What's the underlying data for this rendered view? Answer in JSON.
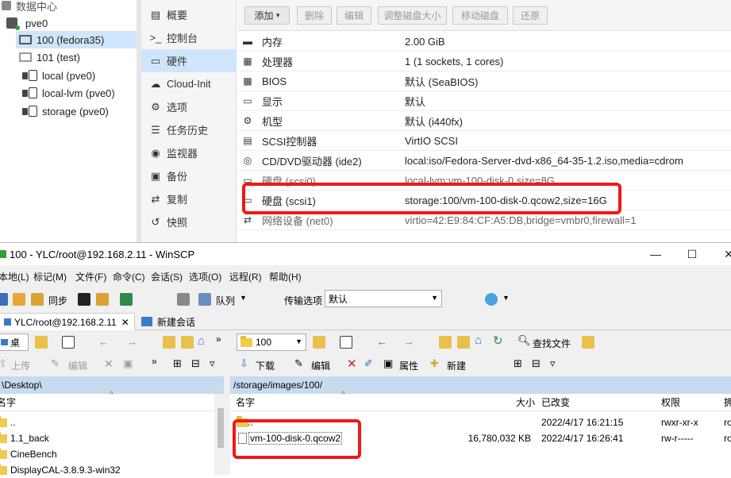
{
  "pve": {
    "tree": {
      "datacenter": "数据中心",
      "node": "pve0",
      "items": [
        {
          "label": "100 (fedora35)",
          "type": "vm",
          "selected": true
        },
        {
          "label": "101 (test)",
          "type": "vm-off"
        },
        {
          "label": "local (pve0)",
          "type": "storage"
        },
        {
          "label": "local-lvm (pve0)",
          "type": "storage"
        },
        {
          "label": "storage (pve0)",
          "type": "storage"
        }
      ]
    },
    "nav": [
      {
        "label": "概要",
        "icon": "document-icon"
      },
      {
        "label": "控制台",
        "icon": "terminal-icon"
      },
      {
        "label": "硬件",
        "icon": "monitor-icon",
        "selected": true
      },
      {
        "label": "Cloud-Init",
        "icon": "cloud-icon"
      },
      {
        "label": "选项",
        "icon": "gear-icon"
      },
      {
        "label": "任务历史",
        "icon": "list-icon"
      },
      {
        "label": "监视器",
        "icon": "eye-icon"
      },
      {
        "label": "备份",
        "icon": "floppy-icon"
      },
      {
        "label": "复制",
        "icon": "retweet-icon"
      },
      {
        "label": "快照",
        "icon": "history-icon"
      }
    ],
    "toolbar": {
      "add": "添加",
      "remove": "删除",
      "edit": "编辑",
      "resize": "调整磁盘大小",
      "move": "移动磁盘",
      "revert": "还原"
    },
    "hardware": [
      {
        "key": "内存",
        "value": "2.00 GiB",
        "icon": "memory-icon"
      },
      {
        "key": "处理器",
        "value": "1 (1 sockets, 1 cores)",
        "icon": "cpu-icon"
      },
      {
        "key": "BIOS",
        "value": "默认 (SeaBIOS)",
        "icon": "chip-icon"
      },
      {
        "key": "显示",
        "value": "默认",
        "icon": "display-icon"
      },
      {
        "key": "机型",
        "value": "默认 (i440fx)",
        "icon": "cogs-icon"
      },
      {
        "key": "SCSI控制器",
        "value": "VirtIO SCSI",
        "icon": "database-icon"
      },
      {
        "key": "CD/DVD驱动器 (ide2)",
        "value": "local:iso/Fedora-Server-dvd-x86_64-35-1.2.iso,media=cdrom",
        "icon": "cdrom-icon"
      },
      {
        "key": "硬盘 (scsi0)",
        "value": "local-lvm:vm-100-disk-0,size=8G",
        "icon": "hdd-icon"
      },
      {
        "key": "硬盘 (scsi1)",
        "value": "storage:100/vm-100-disk-0.qcow2,size=16G",
        "icon": "hdd-icon"
      },
      {
        "key": "网络设备 (net0)",
        "value": "virtio=42:E9:84:CF:A5:DB,bridge=vmbr0,firewall=1",
        "icon": "exchange-icon"
      }
    ]
  },
  "winscp": {
    "title": "100 - YLC/root@192.168.2.11 - WinSCP",
    "menu": [
      "本地(L)",
      "标记(M)",
      "文件(F)",
      "命令(C)",
      "会话(S)",
      "选项(O)",
      "远程(R)",
      "帮助(H)"
    ],
    "sync_label": "同步",
    "queue_label": "队列",
    "transfer_options_label": "传输选项",
    "transfer_default": "默认",
    "session_tab": "YLC/root@192.168.2.11",
    "new_session": "新建会话",
    "local_drive": "桌",
    "remote_dir": "100",
    "find_files": "查找文件",
    "upload": "上传",
    "edit": "编辑",
    "download": "下载",
    "edit2": "编辑",
    "properties": "属性",
    "new": "新建",
    "local_path": "\\Desktop\\",
    "remote_path": "/storage/images/100/",
    "local_columns": {
      "name": "名字"
    },
    "local_files": [
      "..",
      "1.1_back",
      "CineBench",
      "DisplayCAL-3.8.9.3-win32"
    ],
    "remote_columns": {
      "name": "名字",
      "size": "大小",
      "modified": "已改变",
      "rights": "权限",
      "owner": "拥"
    },
    "remote_files": [
      {
        "name": "..",
        "size": "",
        "modified": "2022/4/17 16:21:15",
        "rights": "rwxr-xr-x",
        "owner": "ro"
      },
      {
        "name": "vm-100-disk-0.qcow2",
        "size": "16,780,032 KB",
        "modified": "2022/4/17 16:26:41",
        "rights": "rw-r-----",
        "owner": "ro"
      }
    ],
    "colors": {
      "path_bar": "#c6dbef",
      "highlight": "#f01818"
    }
  }
}
